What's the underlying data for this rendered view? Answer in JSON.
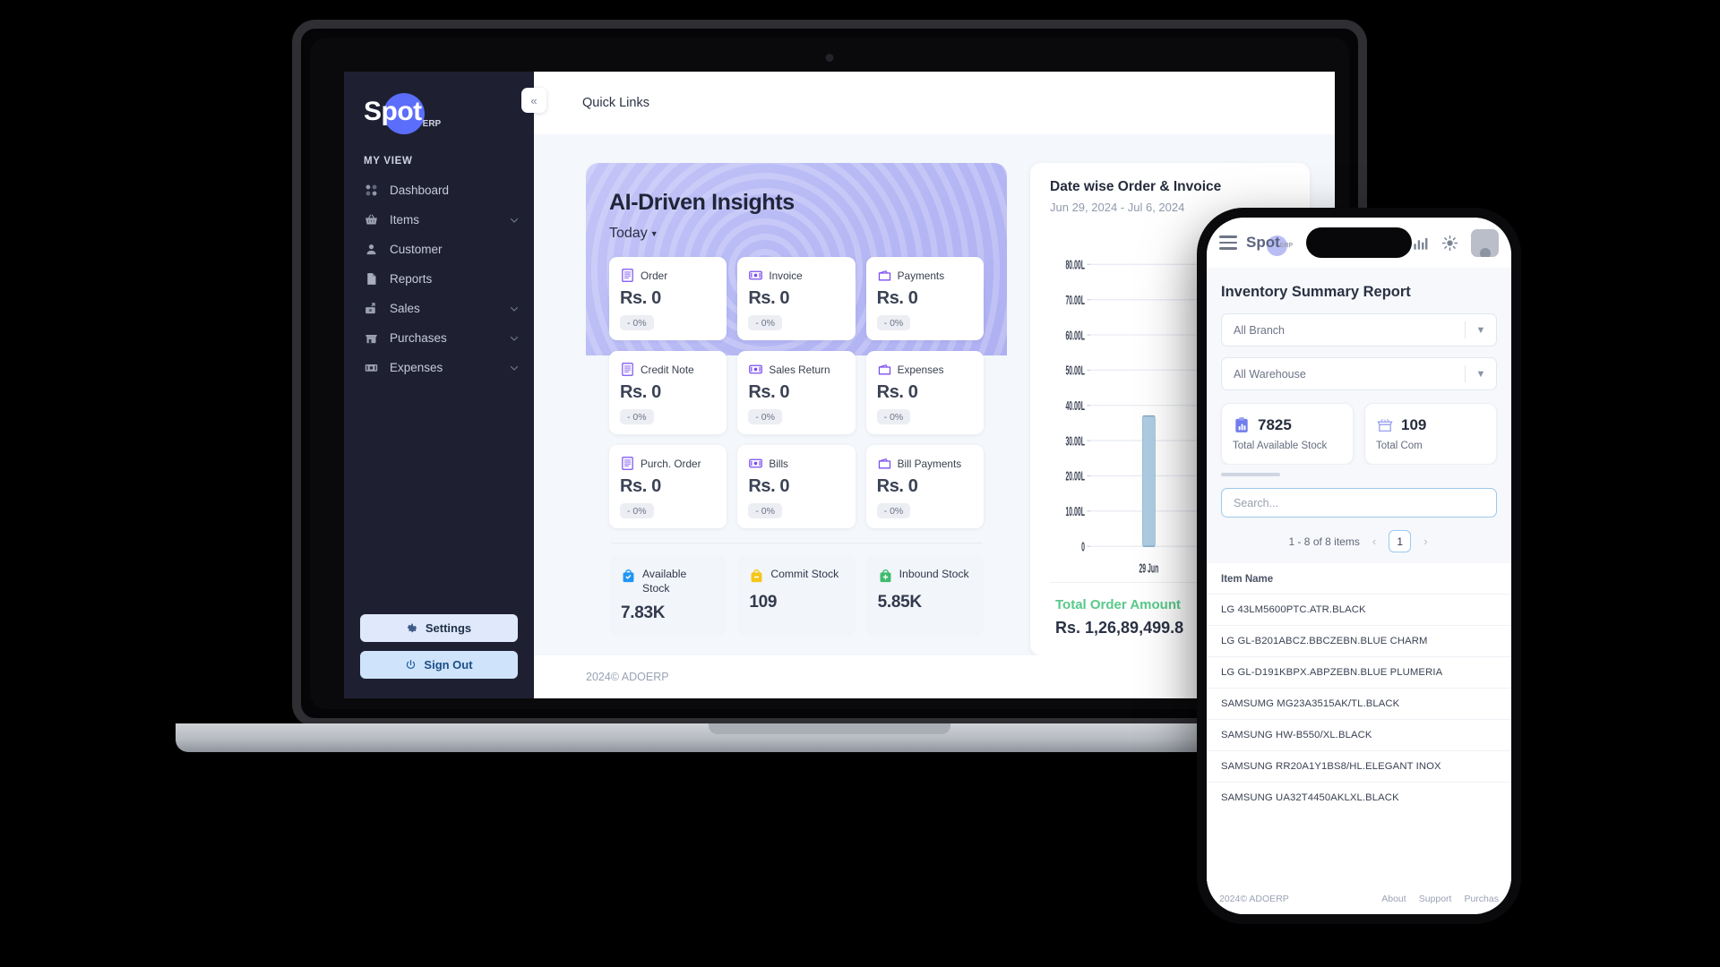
{
  "sidebar": {
    "brand": {
      "name": "Spot",
      "suffix": "ERP"
    },
    "section_label": "MY VIEW",
    "items": [
      {
        "label": "Dashboard",
        "icon": "grid-icon",
        "expandable": false
      },
      {
        "label": "Items",
        "icon": "basket-icon",
        "expandable": true
      },
      {
        "label": "Customer",
        "icon": "user-icon",
        "expandable": false
      },
      {
        "label": "Reports",
        "icon": "document-icon",
        "expandable": false
      },
      {
        "label": "Sales",
        "icon": "sales-money-icon",
        "expandable": true
      },
      {
        "label": "Purchases",
        "icon": "store-icon",
        "expandable": true
      },
      {
        "label": "Expenses",
        "icon": "cash-icon",
        "expandable": true
      }
    ],
    "settings_label": "Settings",
    "signout_label": "Sign Out"
  },
  "topbar": {
    "quick_links": "Quick Links",
    "collapse_icon": "«"
  },
  "insights": {
    "title": "AI-Driven Insights",
    "period": "Today",
    "tiles": [
      {
        "name": "Order",
        "value": "Rs. 0",
        "pct": "- 0%",
        "icon": "receipt-icon"
      },
      {
        "name": "Invoice",
        "value": "Rs. 0",
        "pct": "- 0%",
        "icon": "money-icon"
      },
      {
        "name": "Payments",
        "value": "Rs. 0",
        "pct": "- 0%",
        "icon": "wallet-icon"
      },
      {
        "name": "Credit Note",
        "value": "Rs. 0",
        "pct": "- 0%",
        "icon": "receipt-icon"
      },
      {
        "name": "Sales Return",
        "value": "Rs. 0",
        "pct": "- 0%",
        "icon": "money-icon"
      },
      {
        "name": "Expenses",
        "value": "Rs. 0",
        "pct": "- 0%",
        "icon": "wallet-icon"
      },
      {
        "name": "Purch. Order",
        "value": "Rs. 0",
        "pct": "- 0%",
        "icon": "receipt-icon"
      },
      {
        "name": "Bills",
        "value": "Rs. 0",
        "pct": "- 0%",
        "icon": "money-icon"
      },
      {
        "name": "Bill Payments",
        "value": "Rs. 0",
        "pct": "- 0%",
        "icon": "wallet-icon"
      }
    ],
    "stock_cards": [
      {
        "name": "Available Stock",
        "value": "7.83K",
        "icon": "bag-check-icon",
        "color": "#2196f3"
      },
      {
        "name": "Commit Stock",
        "value": "109",
        "icon": "bag-minus-icon",
        "color": "#f5c518"
      },
      {
        "name": "Inbound Stock",
        "value": "5.85K",
        "icon": "bag-plus-icon",
        "color": "#3dbb6e"
      }
    ]
  },
  "chart_data": {
    "type": "bar",
    "title": "Date wise Order & Invoice",
    "subtitle": "Jun 29, 2024 - Jul 6, 2024",
    "categories": [
      "29 Jun"
    ],
    "series": [
      {
        "name": "Order",
        "values": [
          37.0
        ],
        "color": "#aecde3"
      }
    ],
    "ytick_labels": [
      "80.00L",
      "70.00L",
      "60.00L",
      "50.00L",
      "40.00L",
      "30.00L",
      "20.00L",
      "10.00L",
      "0"
    ],
    "ytick_values": [
      80,
      70,
      60,
      50,
      40,
      30,
      20,
      10,
      0
    ],
    "ylim": [
      0,
      85
    ],
    "xlabel": "",
    "ylabel": "",
    "grid": true,
    "legend": false,
    "total_label": "Total Order Amount",
    "total_value": "Rs. 1,26,89,499.8"
  },
  "footer": {
    "copyright": "2024© ADOERP"
  },
  "phone": {
    "brand": {
      "name": "Spot",
      "suffix": "ERP"
    },
    "title": "Inventory Summary Report",
    "selects": [
      {
        "value": "All Branch",
        "icon": "chevron-down-icon"
      },
      {
        "value": "All Warehouse",
        "icon": "chevron-down-icon"
      }
    ],
    "stats": [
      {
        "value": "7825",
        "label": "Total Available Stock",
        "icon": "clipboard-chart-icon"
      },
      {
        "value": "109",
        "label": "Total Com",
        "icon": "store-icon"
      }
    ],
    "search": {
      "placeholder": "Search...",
      "value": ""
    },
    "pagination": {
      "count_text": "1 - 8 of 8 items",
      "current_page": "1",
      "prev": "‹",
      "next": "›"
    },
    "list": {
      "header": "Item Name",
      "rows": [
        "LG 43LM5600PTC.ATR.BLACK",
        "LG GL-B201ABCZ.BBCZEBN.BLUE CHARM",
        "LG GL-D191KBPX.ABPZEBN.BLUE PLUMERIA",
        "SAMSUMG MG23A3515AK/TL.BLACK",
        "SAMSUNG HW-B550/XL.BLACK",
        "SAMSUNG RR20A1Y1BS8/HL.ELEGANT INOX",
        "SAMSUNG UA32T4450AKLXL.BLACK"
      ]
    },
    "footer": {
      "copyright": "2024© ADOERP",
      "links": [
        "About",
        "Support",
        "Purchas"
      ]
    }
  },
  "colors": {
    "accent": "#5b6dfb",
    "sidebar_bg": "#1e2032",
    "green": "#58c98a",
    "bar": "#aecde3"
  }
}
